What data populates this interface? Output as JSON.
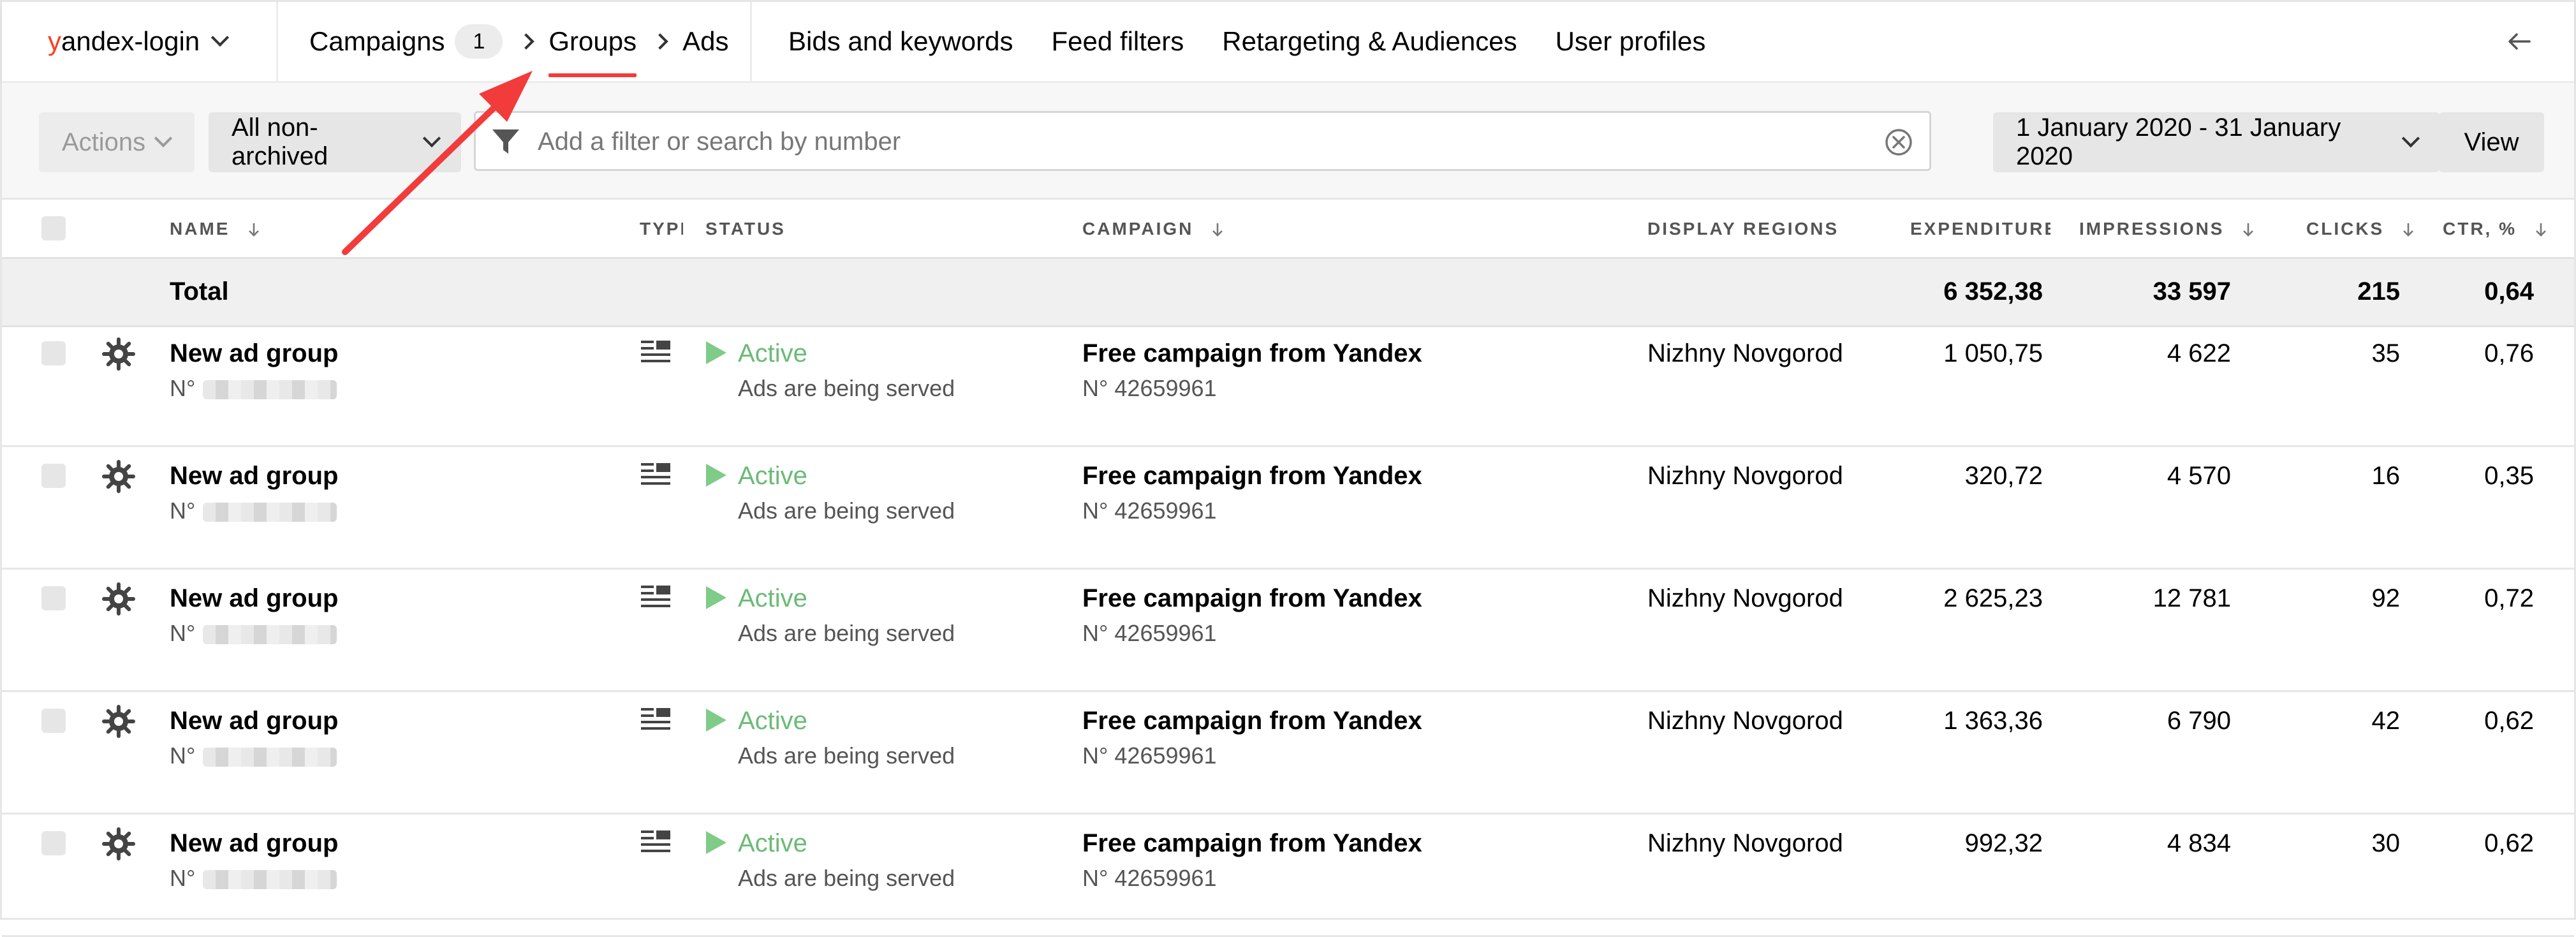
{
  "header": {
    "login_prefix": "y",
    "login_rest": "andex-login",
    "breadcrumbs": {
      "campaigns": "Campaigns",
      "campaigns_count": "1",
      "groups": "Groups",
      "ads": "Ads"
    },
    "nav": [
      "Bids and keywords",
      "Feed filters",
      "Retargeting & Audiences",
      "User profiles"
    ]
  },
  "toolbar": {
    "actions": "Actions",
    "archive_filter": "All non-archived",
    "search_placeholder": "Add a filter or search by number",
    "date_range": "1 January 2020 - 31 January 2020",
    "view": "View"
  },
  "table": {
    "columns": {
      "name": "NAME",
      "type": "TYPE",
      "status": "STATUS",
      "campaign": "CAMPAIGN",
      "regions": "DISPLAY REGIONS",
      "expenditure": "EXPENDITURE,",
      "impressions": "IMPRESSIONS",
      "clicks": "CLICKS",
      "ctr": "CTR, %"
    },
    "total": {
      "label": "Total",
      "expenditure": "6 352,38",
      "impressions": "33 597",
      "clicks": "215",
      "ctr": "0,64"
    },
    "rows": [
      {
        "name": "New ad group",
        "id_prefix": "N°",
        "status": "Active",
        "status_note": "Ads are being served",
        "campaign": "Free campaign from Yandex",
        "campaign_id": "N° 42659961",
        "region": "Nizhny Novgorod",
        "expenditure": "1 050,75",
        "impressions": "4 622",
        "clicks": "35",
        "ctr": "0,76"
      },
      {
        "name": "New ad group",
        "id_prefix": "N°",
        "status": "Active",
        "status_note": "Ads are being served",
        "campaign": "Free campaign from Yandex",
        "campaign_id": "N° 42659961",
        "region": "Nizhny Novgorod",
        "expenditure": "320,72",
        "impressions": "4 570",
        "clicks": "16",
        "ctr": "0,35"
      },
      {
        "name": "New ad group",
        "id_prefix": "N°",
        "status": "Active",
        "status_note": "Ads are being served",
        "campaign": "Free campaign from Yandex",
        "campaign_id": "N° 42659961",
        "region": "Nizhny Novgorod",
        "expenditure": "2 625,23",
        "impressions": "12 781",
        "clicks": "92",
        "ctr": "0,72"
      },
      {
        "name": "New ad group",
        "id_prefix": "N°",
        "status": "Active",
        "status_note": "Ads are being served",
        "campaign": "Free campaign from Yandex",
        "campaign_id": "N° 42659961",
        "region": "Nizhny Novgorod",
        "expenditure": "1 363,36",
        "impressions": "6 790",
        "clicks": "42",
        "ctr": "0,62"
      },
      {
        "name": "New ad group",
        "id_prefix": "N°",
        "status": "Active",
        "status_note": "Ads are being served",
        "campaign": "Free campaign from Yandex",
        "campaign_id": "N° 42659961",
        "region": "Nizhny Novgorod",
        "expenditure": "992,32",
        "impressions": "4 834",
        "clicks": "30",
        "ctr": "0,62"
      }
    ]
  },
  "colors": {
    "brand_red": "#fc3f1d",
    "active_green": "#6bbb77",
    "annotation_red": "#f23b3b"
  },
  "icons": [
    "chevron-down-icon",
    "chevron-right-icon",
    "back-arrow-icon",
    "filter-icon",
    "clear-icon",
    "sort-arrow-icon",
    "gear-icon",
    "text-ad-type-icon",
    "play-icon"
  ]
}
